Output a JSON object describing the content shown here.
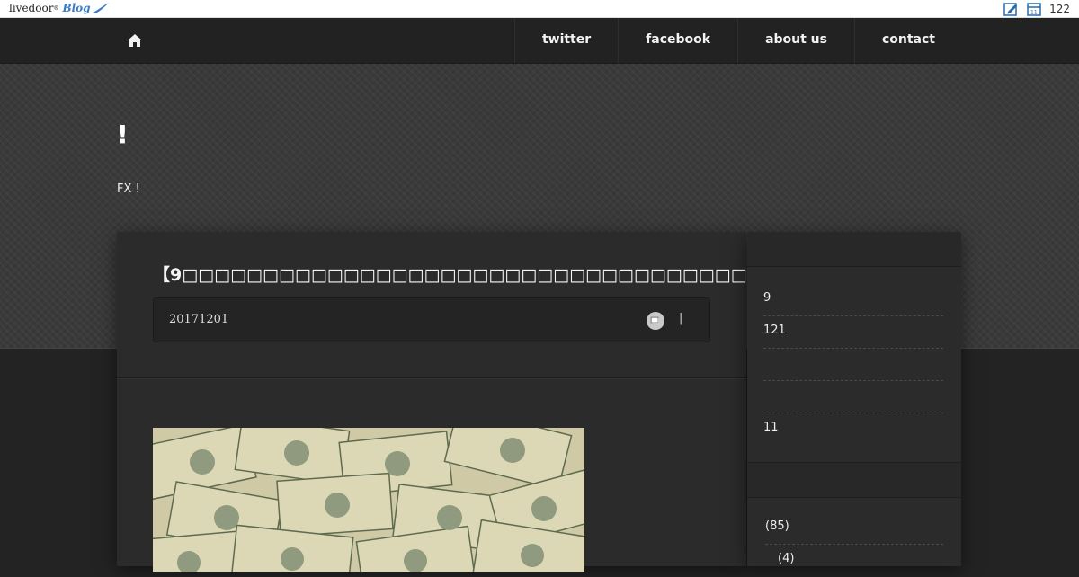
{
  "topbar": {
    "logo_main": "livedoor",
    "logo_sup": "®",
    "logo_blog": "Blog",
    "count": "122"
  },
  "nav": {
    "items": [
      {
        "label": "twitter"
      },
      {
        "label": "facebook"
      },
      {
        "label": "about us"
      },
      {
        "label": "contact"
      }
    ]
  },
  "header": {
    "title": "!",
    "description": "FX !"
  },
  "article": {
    "title": "【9",
    "date": "20171201",
    "separator": "|"
  },
  "sidebar": {
    "items": [
      "9",
      "121",
      "",
      "",
      "11"
    ],
    "counts": [
      "(85)",
      "(4)"
    ]
  },
  "colors": {
    "nav_bg": "#222222",
    "header_bg": "#3a3a3a",
    "panel_bg": "#2b2b2b",
    "blog_blue": "#3a7bc8"
  }
}
